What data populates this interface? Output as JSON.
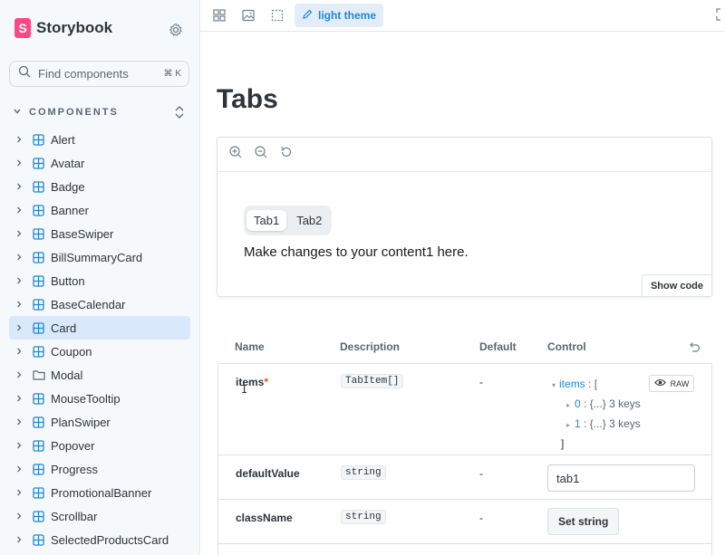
{
  "sidebar": {
    "brand": "Storybook",
    "search_placeholder": "Find components",
    "search_shortcut": "⌘ K",
    "section_label": "COMPONENTS",
    "items": [
      {
        "label": "Alert",
        "icon": "component-icon"
      },
      {
        "label": "Avatar",
        "icon": "component-icon"
      },
      {
        "label": "Badge",
        "icon": "component-icon"
      },
      {
        "label": "Banner",
        "icon": "component-icon"
      },
      {
        "label": "BaseSwiper",
        "icon": "component-icon"
      },
      {
        "label": "BillSummaryCard",
        "icon": "component-icon"
      },
      {
        "label": "Button",
        "icon": "component-icon"
      },
      {
        "label": "BaseCalendar",
        "icon": "component-icon"
      },
      {
        "label": "Card",
        "icon": "component-icon",
        "active": true
      },
      {
        "label": "Coupon",
        "icon": "component-icon"
      },
      {
        "label": "Modal",
        "icon": "folder-icon"
      },
      {
        "label": "MouseTooltip",
        "icon": "component-icon"
      },
      {
        "label": "PlanSwiper",
        "icon": "component-icon"
      },
      {
        "label": "Popover",
        "icon": "component-icon"
      },
      {
        "label": "Progress",
        "icon": "component-icon"
      },
      {
        "label": "PromotionalBanner",
        "icon": "component-icon"
      },
      {
        "label": "Scrollbar",
        "icon": "component-icon"
      },
      {
        "label": "SelectedProductsCard",
        "icon": "component-icon"
      }
    ]
  },
  "toolbar": {
    "theme_label": "light theme"
  },
  "main": {
    "title": "Tabs",
    "preview": {
      "tabs": [
        "Tab1",
        "Tab2"
      ],
      "content": "Make changes to your content1 here.",
      "show_code": "Show code"
    },
    "args_table": {
      "headers": {
        "name": "Name",
        "description": "Description",
        "default": "Default",
        "control": "Control"
      },
      "rows": [
        {
          "name": "items",
          "required": "*",
          "type": "TabItem[]",
          "default": "-",
          "control": {
            "key": "items",
            "sep": " : [",
            "entries": [
              {
                "index": "0",
                "summary": ": {...} 3 keys"
              },
              {
                "index": "1",
                "summary": ": {...} 3 keys"
              }
            ],
            "close": "]",
            "raw_label": "RAW"
          }
        },
        {
          "name": "defaultValue",
          "type": "string",
          "default": "-",
          "value": "tab1"
        },
        {
          "name": "className",
          "type": "string",
          "default": "-",
          "button": "Set string"
        }
      ]
    }
  },
  "colors": {
    "accent": "#1e87d6",
    "brand": "#ff4785",
    "active_bg": "#d9e8fa"
  }
}
